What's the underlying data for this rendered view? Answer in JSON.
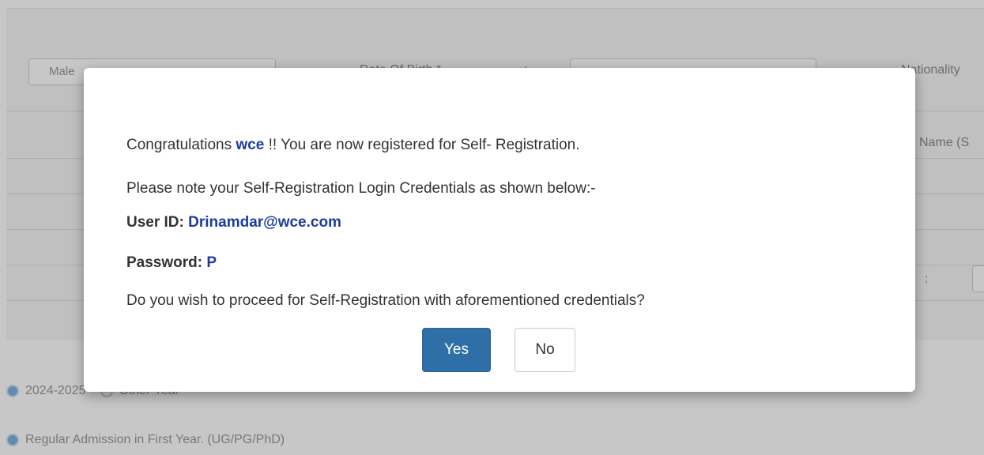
{
  "background": {
    "gender_value": "Male",
    "dob_label": "Date Of Birth *",
    "dob_colon": ":",
    "nationality_label": "Nationality",
    "name_label": "Name (S",
    "colon": ":",
    "year_option_selected": "2024-2025",
    "year_option_other": "Other Year",
    "admission_option": "Regular Admission in First Year. (UG/PG/PhD)"
  },
  "modal": {
    "line1_prefix": "Congratulations ",
    "line1_user": "wce",
    "line1_suffix": " !! You are now registered for Self- Registration.",
    "line2": "Please note your Self-Registration Login Credentials as shown below:-",
    "userid_label": "User ID: ",
    "userid_value": "Drinamdar@wce.com",
    "password_label": "Password: ",
    "password_value": "P",
    "question": "Do you wish to proceed for Self-Registration with aforementioned credentials?",
    "yes_label": "Yes",
    "no_label": "No"
  },
  "colors": {
    "accent_blue": "#2f6fa8",
    "highlight_text": "#1d3c9e"
  }
}
